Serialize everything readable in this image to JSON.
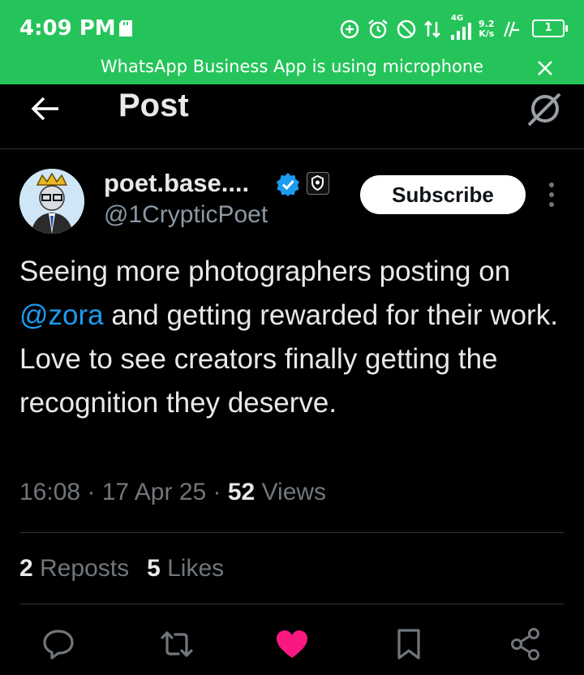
{
  "status_bar": {
    "time": "4:09 PM",
    "network": "4G",
    "speed_value": "9.2",
    "speed_unit": "K/s",
    "battery": "1",
    "banner": "WhatsApp Business App is using microphone"
  },
  "header": {
    "title": "Post"
  },
  "author": {
    "name": "poet.base....",
    "handle": "@1CrypticPoet",
    "subscribe_label": "Subscribe"
  },
  "post": {
    "text_before": "Seeing more photographers posting on ",
    "mention": "@zora",
    "text_after": " and getting rewarded for their work. Love to see creators finally getting the recognition they deserve.",
    "time": "16:08",
    "date": "17 Apr 25",
    "views_count": "52",
    "views_label": "Views",
    "separator": " · "
  },
  "stats": {
    "reposts_count": "2",
    "reposts_label": "Reposts",
    "likes_count": "5",
    "likes_label": "Likes"
  },
  "colors": {
    "status_bar": "#25c45a",
    "accent": "#1d9bf0",
    "like": "#f91880",
    "background": "#000000"
  },
  "icons": [
    "back-icon",
    "grok-icon",
    "verified-icon",
    "shield-icon",
    "more-icon",
    "reply-icon",
    "repost-icon",
    "like-icon",
    "bookmark-icon",
    "share-icon"
  ]
}
